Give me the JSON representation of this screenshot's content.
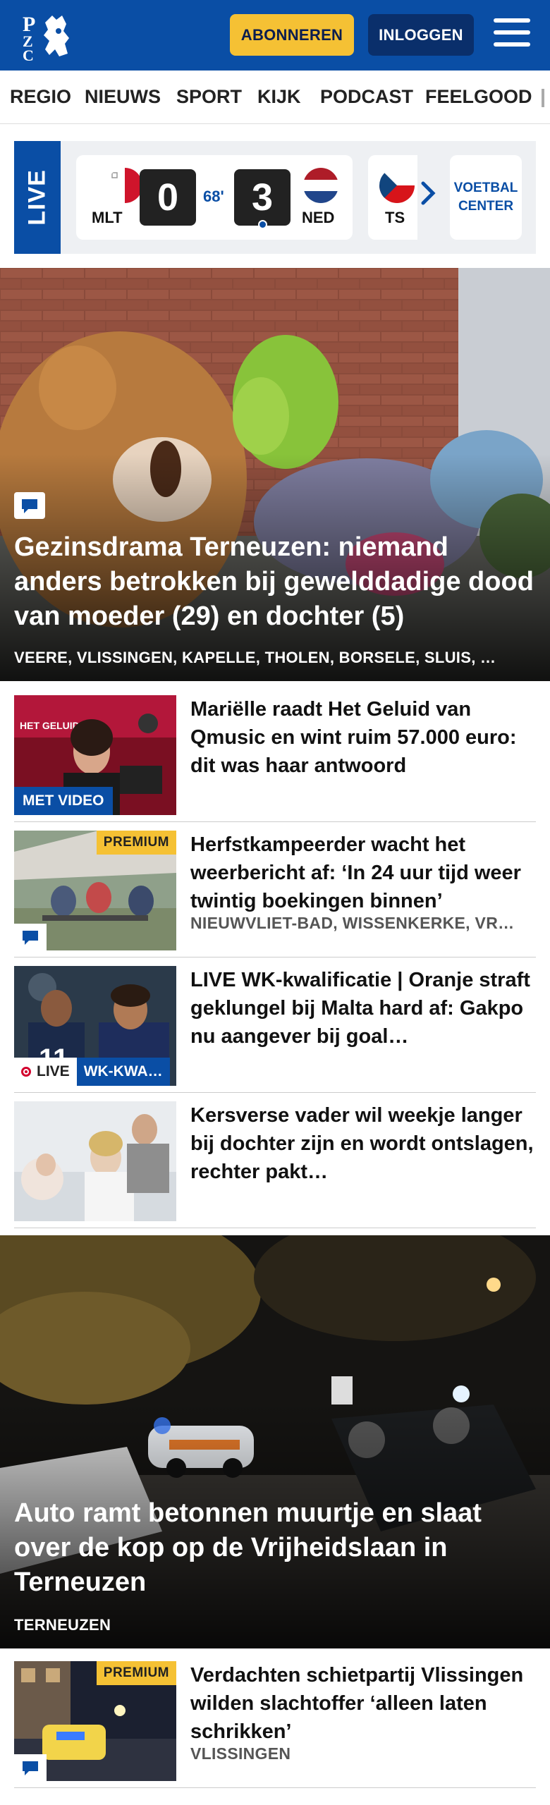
{
  "header": {
    "logo_text": "PZC",
    "subscribe_label": "ABONNEREN",
    "login_label": "INLOGGEN",
    "menu_icon": "hamburger-menu-icon",
    "brand_color": "#0a4ea5",
    "accent_color": "#f5c134"
  },
  "nav": {
    "items": [
      "REGIO",
      "NIEUWS",
      "SPORT",
      "KIJK",
      "PODCAST",
      "FEELGOOD"
    ]
  },
  "live_scores": {
    "label": "LIVE",
    "match": {
      "home_code": "MLT",
      "home_score": "0",
      "minute": "68'",
      "away_score": "3",
      "away_code": "NED"
    },
    "next_match_code": "TS",
    "center_label": "VOETBAL CENTER"
  },
  "hero": {
    "title": "Gezinsdrama Terneuzen: niemand anders betrokken bij gewelddadige dood van moeder (29) en dochter (5)",
    "locations": "VEERE, VLISSINGEN, KAPELLE, THOLEN, BORSELE, SLUIS, …"
  },
  "articles": [
    {
      "title": "Mariëlle raadt Het Geluid van Qmusic en wint ruim 57.000 euro: dit was haar antwoord",
      "badge": "MET VIDEO"
    },
    {
      "title": "Herfstkampeerder wacht het weerbericht af: ‘In 24 uur tijd weer twintig boekingen binnen’",
      "badge": "PREMIUM",
      "location": "NIEUWVLIET-BAD, WISSENKERKE, VR…"
    },
    {
      "title": "LIVE WK-kwalificatie | Oranje straft geklungel bij Malta hard af: Gakpo nu aangever bij goal…",
      "live_label": "LIVE",
      "tag": "WK-KWA…"
    },
    {
      "title": "Kersverse vader wil weekje langer bij dochter zijn en wordt ontslagen, rechter pakt…"
    }
  ],
  "hero2": {
    "title": "Auto ramt betonnen muurtje en slaat over de kop op de Vrijheidslaan in Terneuzen",
    "location": "TERNEUZEN"
  },
  "article_bottom": {
    "title": "Verdachten schietpartij Vlissingen wilden slachtoffer ‘alleen laten schrikken’",
    "badge": "PREMIUM",
    "location": "VLISSINGEN"
  }
}
